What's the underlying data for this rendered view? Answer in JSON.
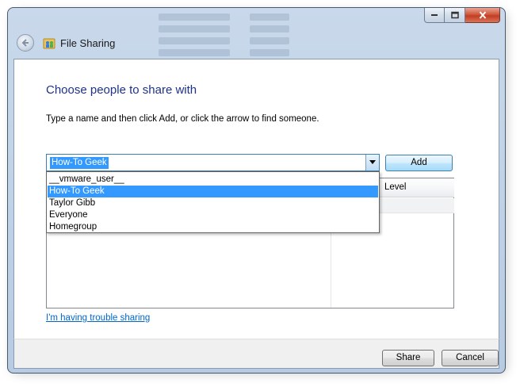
{
  "window": {
    "title": "File Sharing",
    "icons": {
      "back": "back-arrow-icon",
      "app": "file-sharing-people-icon",
      "minimize": "minimize-icon",
      "maximize": "maximize-icon",
      "close": "close-icon"
    }
  },
  "main": {
    "heading": "Choose people to share with",
    "instructions": "Type a name and then click Add, or click the arrow to find someone.",
    "name_input": {
      "value": "How-To Geek",
      "dropdown_icon": "chevron-down-icon"
    },
    "add_label": "Add",
    "dropdown_options": [
      "__vmware_user__",
      "How-To Geek",
      "Taylor Gibb",
      "Everyone",
      "Homegroup"
    ],
    "selected_option": "How-To Geek",
    "list": {
      "column_permission": "Level"
    },
    "trouble_link": "I'm having trouble sharing"
  },
  "footer": {
    "share_label": "Share",
    "cancel_label": "Cancel"
  },
  "colors": {
    "heading": "#1e3287",
    "link": "#0066cc",
    "selection": "#3399ff",
    "glass_frame": "#c9d9eb",
    "close_button": "#c13d21"
  }
}
